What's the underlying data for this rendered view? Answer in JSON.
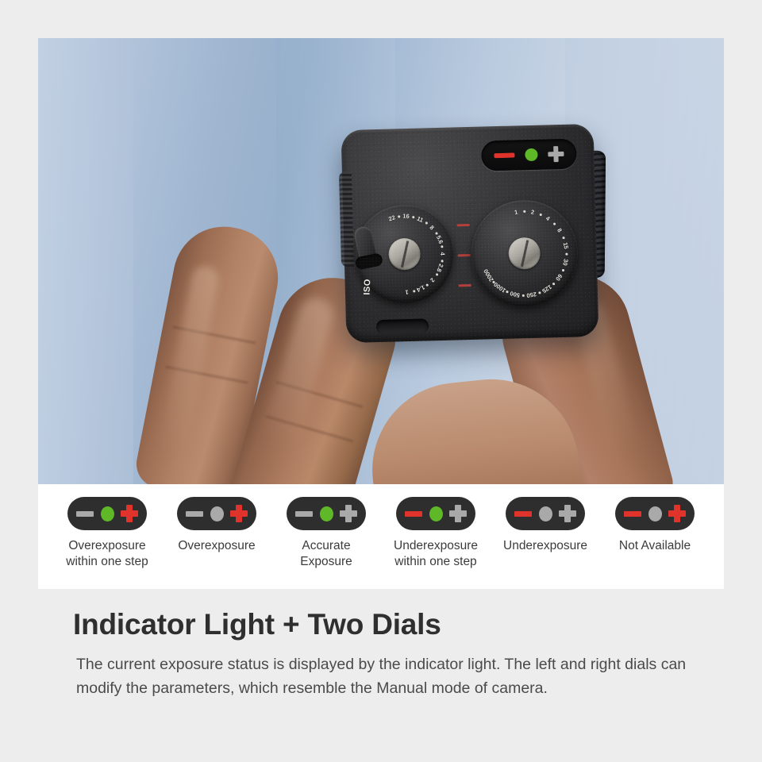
{
  "photo": {
    "alt_name": "hand-holding-light-meter",
    "device": {
      "indicator_window": {
        "minus_color": "#e0332c",
        "dot_color": "#5fb828",
        "plus_color": "#a9a9a9",
        "state": "Underexposure within one step"
      },
      "left_dial": {
        "name": "aperture-dial",
        "iso_label": "ISO",
        "ticks": [
          "22",
          "16",
          "11",
          "8",
          "5.6",
          "4",
          "2.8",
          "2",
          "1.4",
          "1"
        ]
      },
      "right_dial": {
        "name": "shutter-speed-dial",
        "ticks": [
          "1",
          "2",
          "4",
          "8",
          "15",
          "30",
          "60",
          "125",
          "250",
          "500",
          "1000",
          "2000"
        ]
      }
    }
  },
  "legend": {
    "items": [
      {
        "label_line1": "Overexposure",
        "label_line2": "within one step",
        "minus_color": "#a9a9a9",
        "dot_color": "#5fb828",
        "plus_color": "#e0332c"
      },
      {
        "label_line1": "Overexposure",
        "label_line2": "",
        "minus_color": "#a9a9a9",
        "dot_color": "#a9a9a9",
        "plus_color": "#e0332c"
      },
      {
        "label_line1": "Accurate",
        "label_line2": "Exposure",
        "minus_color": "#a9a9a9",
        "dot_color": "#5fb828",
        "plus_color": "#a9a9a9"
      },
      {
        "label_line1": "Underexposure",
        "label_line2": "within one step",
        "minus_color": "#e0332c",
        "dot_color": "#5fb828",
        "plus_color": "#a9a9a9"
      },
      {
        "label_line1": "Underexposure",
        "label_line2": "",
        "minus_color": "#e0332c",
        "dot_color": "#a9a9a9",
        "plus_color": "#a9a9a9"
      },
      {
        "label_line1": "Not Available",
        "label_line2": "",
        "minus_color": "#e0332c",
        "dot_color": "#a9a9a9",
        "plus_color": "#e0332c"
      }
    ]
  },
  "content": {
    "headline": "Indicator Light + Two Dials",
    "body": "The current exposure status is displayed by the indicator light. The left and right dials can modify the parameters, which resemble the Manual mode of camera."
  },
  "colors": {
    "page_background": "#ededee",
    "panel_background": "#ffffff",
    "headline_color": "#2f2f2f",
    "body_color": "#4a4a4a",
    "badge_background": "#2e2e2e",
    "red": "#e0332c",
    "green": "#5fb828",
    "gray": "#a9a9a9"
  }
}
